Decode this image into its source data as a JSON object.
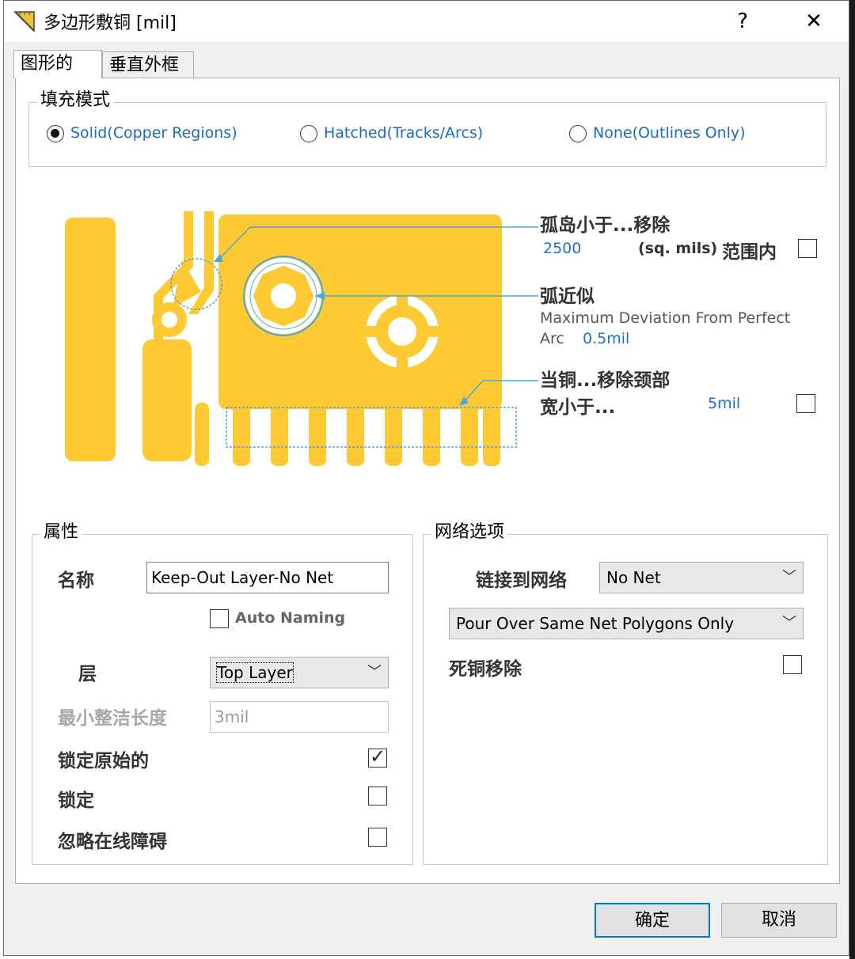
{
  "window": {
    "title": "多边形敷铜 [mil]",
    "help": "?",
    "close": "✕"
  },
  "tabs": [
    {
      "label": "图形的"
    },
    {
      "label": "垂直外框"
    }
  ],
  "fill_mode": {
    "group_label": "填充模式",
    "options": [
      {
        "label": "Solid(Copper Regions)",
        "selected": true
      },
      {
        "label": "Hatched(Tracks/Arcs)",
        "selected": false
      },
      {
        "label": "None(Outlines Only)",
        "selected": false
      }
    ]
  },
  "island": {
    "heading": "孤岛小于...移除",
    "value": "2500",
    "unit": "(sq. mils)",
    "range_label": "范围内",
    "checked": false
  },
  "arc": {
    "heading": "弧近似",
    "desc": "Maximum Deviation From Perfect",
    "desc2": "Arc",
    "value": "0.5mil"
  },
  "neck": {
    "heading": "当铜...移除颈部",
    "heading2": "宽小于...",
    "value": "5mil",
    "checked": false
  },
  "properties": {
    "group_label": "属性",
    "name_label": "名称",
    "name_value": "Keep-Out Layer-No Net",
    "auto_naming": "Auto Naming",
    "auto_naming_checked": false,
    "layer_label": "层",
    "layer_value": "Top Layer",
    "min_length_label": "最小整洁长度",
    "min_length_value": "3mil",
    "lock_primitives_label": "锁定原始的",
    "lock_primitives_checked": true,
    "locked_label": "锁定",
    "locked_checked": false,
    "ignore_drc_label": "忽略在线障碍",
    "ignore_drc_checked": false
  },
  "net_options": {
    "group_label": "网络选项",
    "connect_label": "链接到网络",
    "net_value": "No Net",
    "pour_value": "Pour Over Same Net Polygons Only",
    "remove_dead_label": "死铜移除",
    "remove_dead_checked": false
  },
  "buttons": {
    "ok": "确定",
    "cancel": "取消"
  },
  "colors": {
    "copper": "#ffc933",
    "link_blue": "#1a6cc0",
    "leader_line": "#4aa8d8"
  }
}
